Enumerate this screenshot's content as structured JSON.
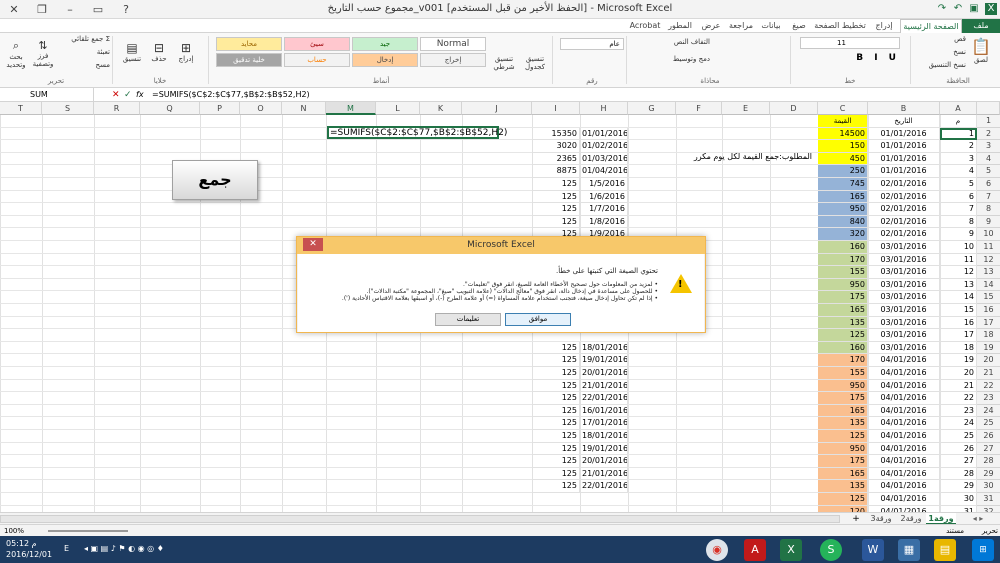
{
  "window": {
    "title": "مجموع حسب التاريخ_v001 [الحفظ الأخير من قبل المستخدم] - Microsoft Excel"
  },
  "ribbon": {
    "tabs": [
      "ملف",
      "الصفحة الرئيسية",
      "إدراج",
      "تخطيط الصفحة",
      "صيغ",
      "بيانات",
      "مراجعة",
      "عرض",
      "المطور",
      "Acrobat"
    ],
    "active_tab": "الصفحة الرئيسية",
    "groups": [
      "الحافظة",
      "خط",
      "محاذاة",
      "رقم",
      "أنماط",
      "خلايا",
      "تحرير"
    ],
    "clipboard": [
      "قص",
      "نسخ",
      "نسخ التنسيق",
      "لصق"
    ],
    "font_size": "11",
    "alignment": [
      "التفاف النص",
      "دمج وتوسيط"
    ],
    "number_format": "عام",
    "style_buttons": [
      "تنسيق شرطي",
      "تنسيق كجدول"
    ],
    "styles": [
      "Normal",
      "جيد",
      "سيئ",
      "محايد",
      "إخراج",
      "إدخال",
      "حساب",
      "خلية تدقيق"
    ],
    "cells": [
      "إدراج",
      "حذف",
      "تنسيق"
    ],
    "editing": [
      "جمع تلقائي",
      "تعبئة",
      "مسح",
      "فرز وتصفية",
      "بحث وتحديد"
    ]
  },
  "formula_bar": {
    "name_box": "SUM",
    "formula": "=SUMIFS($C$2:$C$77,$B$2:$B$52,H2)",
    "fx": "fx"
  },
  "columns": [
    "A",
    "B",
    "C",
    "D",
    "E",
    "F",
    "G",
    "H",
    "I",
    "J",
    "K",
    "L",
    "M",
    "N",
    "O",
    "P",
    "Q",
    "R",
    "S",
    "T"
  ],
  "selected_column": "M",
  "rows": [
    "1",
    "2",
    "3",
    "4",
    "5",
    "6",
    "7",
    "8",
    "9",
    "10",
    "11",
    "12",
    "13",
    "14",
    "15",
    "16",
    "17",
    "18",
    "19",
    "20",
    "21",
    "22",
    "23",
    "24",
    "25",
    "26",
    "27",
    "28",
    "29",
    "30",
    "31",
    "32",
    "33"
  ],
  "sheet": {
    "header_m": "م",
    "header_b": "التاريخ",
    "header_c": "القيمة",
    "a_values": [
      "1",
      "2",
      "3",
      "4",
      "5",
      "6",
      "7",
      "8",
      "9",
      "10",
      "11",
      "12",
      "13",
      "14",
      "15",
      "16",
      "17",
      "18",
      "19",
      "20",
      "21",
      "22",
      "23",
      "24",
      "25",
      "26",
      "27",
      "28",
      "29",
      "30",
      "31",
      "32"
    ],
    "b_values": [
      "01/01/2016",
      "01/01/2016",
      "01/01/2016",
      "01/01/2016",
      "02/01/2016",
      "02/01/2016",
      "02/01/2016",
      "02/01/2016",
      "02/01/2016",
      "03/01/2016",
      "03/01/2016",
      "03/01/2016",
      "03/01/2016",
      "03/01/2016",
      "03/01/2016",
      "03/01/2016",
      "03/01/2016",
      "03/01/2016",
      "04/01/2016",
      "04/01/2016",
      "04/01/2016",
      "04/01/2016",
      "04/01/2016",
      "04/01/2016",
      "04/01/2016",
      "04/01/2016",
      "04/01/2016",
      "04/01/2016",
      "04/01/2016",
      "04/01/2016",
      "04/01/2016",
      "04/01/2016"
    ],
    "c_values": [
      "14500",
      "150",
      "450",
      "250",
      "745",
      "165",
      "950",
      "840",
      "320",
      "160",
      "170",
      "155",
      "950",
      "175",
      "165",
      "135",
      "125",
      "160",
      "170",
      "155",
      "950",
      "175",
      "165",
      "135",
      "125",
      "950",
      "175",
      "165",
      "135",
      "125",
      "120",
      "170"
    ],
    "c_colors": [
      "#ffff00",
      "#ffff00",
      "#ffff00",
      "#95b3d7",
      "#95b3d7",
      "#95b3d7",
      "#95b3d7",
      "#95b3d7",
      "#95b3d7",
      "#c4d79b",
      "#c4d79b",
      "#c4d79b",
      "#c4d79b",
      "#c4d79b",
      "#c4d79b",
      "#c4d79b",
      "#c4d79b",
      "#c4d79b",
      "#fabf8f",
      "#fabf8f",
      "#fabf8f",
      "#fabf8f",
      "#fabf8f",
      "#fabf8f",
      "#fabf8f",
      "#fabf8f",
      "#fabf8f",
      "#fabf8f",
      "#fabf8f",
      "#fabf8f",
      "#fabf8f",
      "#fabf8f"
    ],
    "task_note": "المطلوب:جمع القيمة لكل يوم مكرر",
    "h_values": [
      "01/01/2016",
      "01/02/2016",
      "01/03/2016",
      "01/04/2016",
      "1/5/2016",
      "1/6/2016",
      "1/7/2016",
      "1/8/2016",
      "1/9/2016",
      "",
      "",
      "",
      "",
      "",
      "",
      "",
      "",
      "18/01/2016",
      "19/01/2016",
      "20/01/2016",
      "21/01/2016",
      "22/01/2016",
      "16/01/2016",
      "17/01/2016",
      "18/01/2016",
      "19/01/2016",
      "20/01/2016",
      "21/01/2016",
      "22/01/2016"
    ],
    "i_values": [
      "15350",
      "3020",
      "2365",
      "8875",
      "125",
      "125",
      "125",
      "125",
      "125",
      "",
      "",
      "",
      "",
      "",
      "",
      "",
      "",
      "125",
      "125",
      "125",
      "125",
      "125",
      "125",
      "125",
      "125",
      "125",
      "125",
      "125",
      "125"
    ],
    "m_edit": "=SUMIFS($C$2:$C$77,$B$2:$B$52,H2)",
    "button_label": "جمع"
  },
  "dialog": {
    "title": "Microsoft Excel",
    "close": "✕",
    "headline": "تحتوي الصيغة التي كتبتها على خطأ.",
    "bullets": [
      "لمزيد من المعلومات حول تصحيح الأخطاء العامة للصيغ، انقر فوق \"تعليمات\".",
      "للحصول على مساعدة في إدخال دالة، انقر فوق \"معالج الدالات\" (علامة التبويب \"صيغ\"، المجموعة \"مكتبة الدالات\").",
      "إذا لم تكن تحاول إدخال صيغة، فتجنب استخدام علامة المساواة (=) أو علامة الطرح (-)، أو اسبقها بعلامة الاقتباس الأحادية (')."
    ],
    "ok": "موافق",
    "help": "تعليمات"
  },
  "sheet_tabs": [
    "ورقة1",
    "ورقة2",
    "ورقة3"
  ],
  "status": {
    "mode": "تحرير",
    "sub": "مستند",
    "zoom": "100%"
  },
  "taskbar": {
    "time": "05:12 م",
    "date": "2016/12/01",
    "lang": "E"
  }
}
